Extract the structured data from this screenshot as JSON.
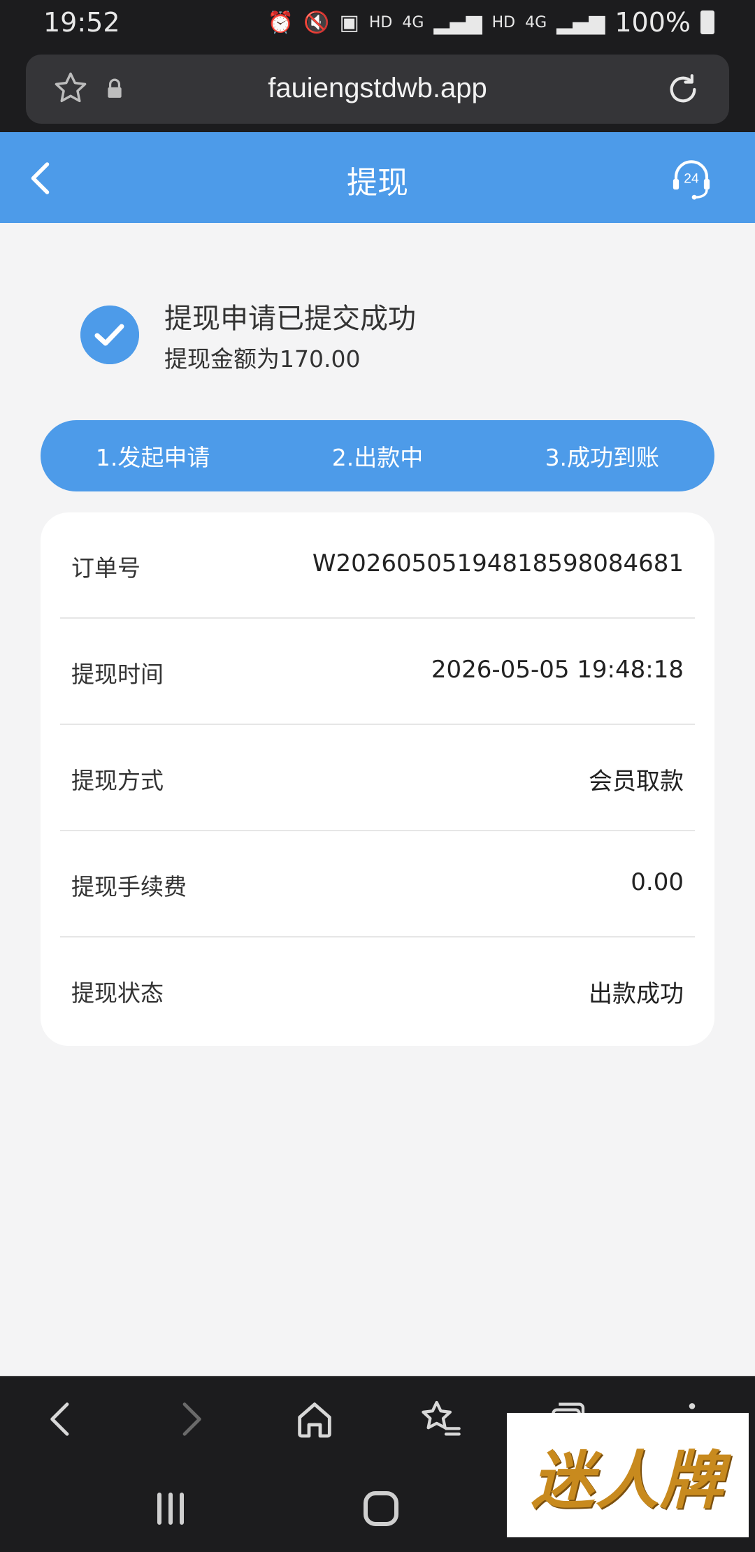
{
  "status_bar": {
    "time": "19:52",
    "network_1": "HD",
    "network_2": "4G",
    "network_3": "HD",
    "network_4": "4G",
    "battery": "100%"
  },
  "browser": {
    "url": "fauiengstdwb.app"
  },
  "header": {
    "title": "提现"
  },
  "success": {
    "title": "提现申请已提交成功",
    "amount_text": "提现金额为170.00"
  },
  "steps": [
    {
      "label": "1.发起申请"
    },
    {
      "label": "2.出款中"
    },
    {
      "label": "3.成功到账"
    }
  ],
  "details": [
    {
      "label": "订单号",
      "value": "W20260505194818598084681"
    },
    {
      "label": "提现时间",
      "value": "2026-05-05 19:48:18"
    },
    {
      "label": "提现方式",
      "value": "会员取款"
    },
    {
      "label": "提现手续费",
      "value": "0.00"
    },
    {
      "label": "提现状态",
      "value": "出款成功"
    }
  ],
  "watermark": {
    "text": "迷人牌"
  },
  "colors": {
    "accent": "#4d9be9",
    "dark_bar": "#1c1c1e",
    "background": "#f4f4f5",
    "watermark_gold": "#c88a1e"
  },
  "support_badge": "24"
}
